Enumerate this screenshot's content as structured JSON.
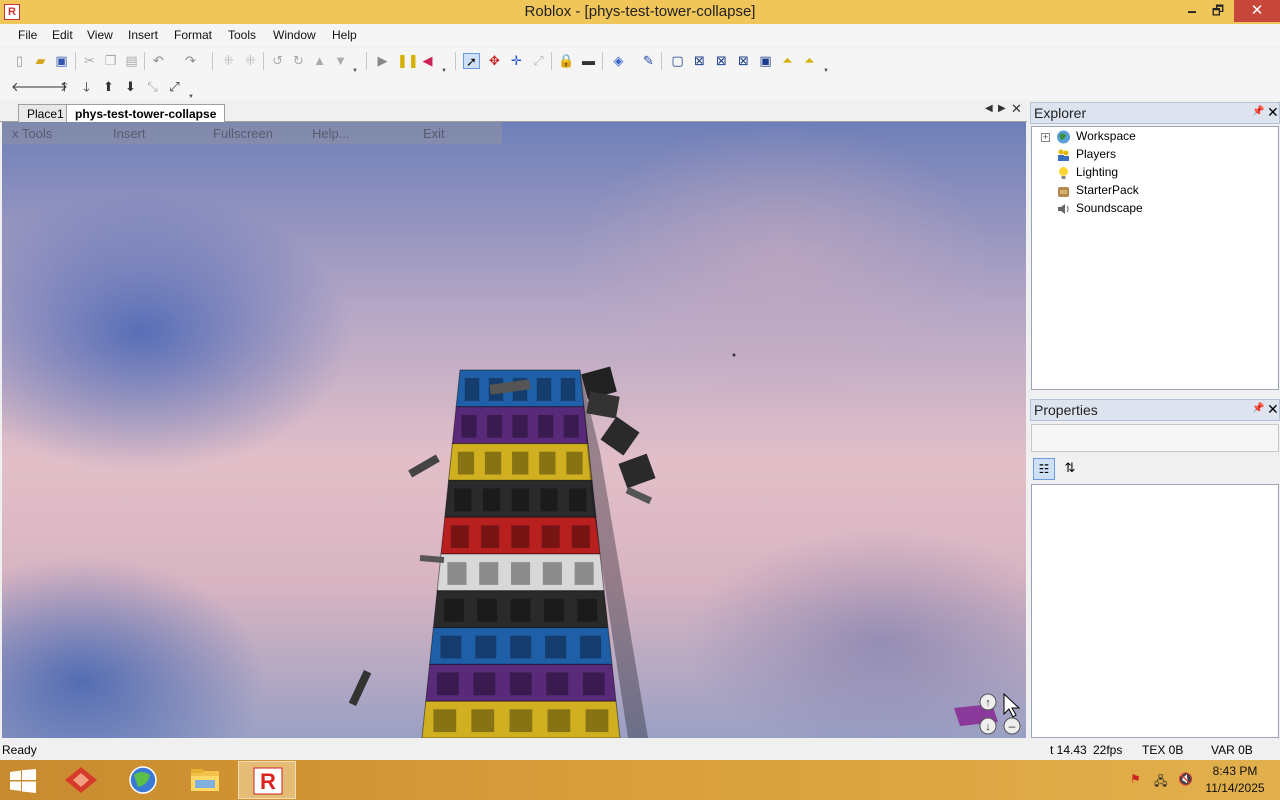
{
  "window": {
    "title": "Roblox - [phys-test-tower-collapse]",
    "minimize": "🗕",
    "restore": "🗗",
    "close": "✕"
  },
  "menu": [
    "File",
    "Edit",
    "View",
    "Insert",
    "Format",
    "Tools",
    "Window",
    "Help"
  ],
  "toolbar1_icons": [
    "new-icon",
    "open-icon",
    "save-icon",
    "cut-icon",
    "copy-icon",
    "paste-icon",
    "undo-icon",
    "redo-icon",
    "group-icon",
    "ungroup-icon",
    "rotate-left-icon",
    "rotate-right-icon",
    "move-up-icon",
    "move-down-icon",
    "play-icon",
    "pause-icon",
    "reset-icon",
    "select-icon",
    "move-icon",
    "scale-icon",
    "resize-icon",
    "lock-icon",
    "anchor-icon",
    "paint-icon",
    "material-icon",
    "box-icon",
    "box-x1-icon",
    "box-x2-icon",
    "box-x3-icon",
    "box-solid-icon",
    "triangle-up-icon",
    "triangle-arrow-icon"
  ],
  "toolbar2_icons": [
    "arrow-left-icon",
    "arrow-right-icon",
    "turn-up-icon",
    "turn-down-icon",
    "arrow-up-icon",
    "arrow-down-icon",
    "fit-inward-icon",
    "fit-outward-icon"
  ],
  "tabs": {
    "place1": "Place1",
    "active": "phys-test-tower-collapse"
  },
  "ingame_menu": [
    "x Tools",
    "Insert",
    "Fullscreen",
    "Help...",
    "Exit"
  ],
  "explorer": {
    "title": "Explorer",
    "items": [
      {
        "label": "Workspace",
        "icon": "globe-icon",
        "color": "#3a8f3a"
      },
      {
        "label": "Players",
        "icon": "players-icon",
        "color": "#3b6fbf"
      },
      {
        "label": "Lighting",
        "icon": "lightbulb-icon",
        "color": "#e6b800"
      },
      {
        "label": "StarterPack",
        "icon": "backpack-icon",
        "color": "#8a6a3a"
      },
      {
        "label": "Soundscape",
        "icon": "speaker-icon",
        "color": "#555555"
      }
    ]
  },
  "properties": {
    "title": "Properties"
  },
  "status": {
    "left": "Ready",
    "time": "t 14.43",
    "fps": "22fps",
    "tex": "TEX 0B",
    "var": "VAR 0B"
  },
  "clock": {
    "time": "8:43 PM",
    "date": "11/14/2025"
  },
  "colors": {
    "titlebar": "#f0c55a",
    "taskbar": "#d99f3c",
    "tower_floors": [
      "#1f5fa8",
      "#5a2a7a",
      "#d0b020",
      "#2a2a2a",
      "#b82020",
      "#d8d8d8",
      "#2a2a2a",
      "#1f5fa8",
      "#5a2a7a",
      "#d0b020"
    ]
  }
}
